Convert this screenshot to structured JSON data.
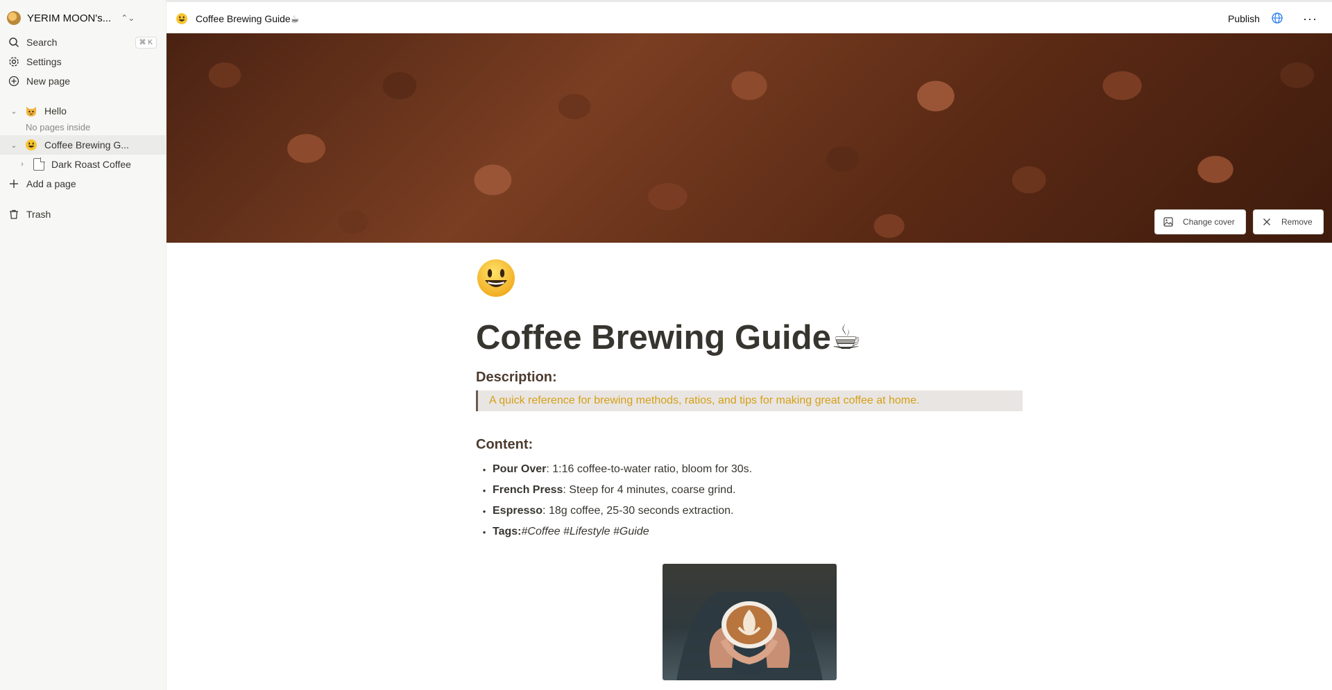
{
  "sidebar": {
    "workspace_name": "YERIM MOON's...",
    "nav": {
      "search_label": "Search",
      "search_shortcut": "⌘ K",
      "settings_label": "Settings",
      "new_page_label": "New page"
    },
    "tree": [
      {
        "label": "Hello",
        "icon": "cat-face-emoji",
        "expanded": true
      },
      {
        "label": "Coffee Brewing G...",
        "icon": "smiley-emoji",
        "expanded": true,
        "active": true
      },
      {
        "label": "Dark Roast Coffee",
        "icon": "document-icon",
        "expanded": false
      }
    ],
    "no_pages_text": "No pages inside",
    "add_page_label": "Add a page",
    "trash_label": "Trash"
  },
  "topbar": {
    "breadcrumb": "Coffee Brewing Guide☕",
    "publish_label": "Publish",
    "more_label": "···"
  },
  "cover": {
    "change_label": "Change cover",
    "remove_label": "Remove"
  },
  "page": {
    "title": "Coffee Brewing Guide☕",
    "description_heading": "Description:",
    "description_text": "A quick reference for brewing methods, ratios, and tips for making great coffee at home.",
    "content_heading": "Content:",
    "items": [
      {
        "bold": "Pour Over",
        "rest": ": 1:16 coffee-to-water ratio, bloom for 30s."
      },
      {
        "bold": "French Press",
        "rest": ": Steep for 4 minutes, coarse grind."
      },
      {
        "bold": "Espresso",
        "rest": ": 18g coffee, 25-30 seconds extraction."
      },
      {
        "bold": "Tags:",
        "rest": " #Coffee #Lifestyle #Guide"
      }
    ]
  },
  "colors": {
    "sidebar_bg": "#f7f7f5",
    "heading_brown": "#4d3b2f",
    "quote_text": "#d4a017",
    "quote_bg": "#e9e5e2",
    "link_blue": "#2f80ed"
  }
}
